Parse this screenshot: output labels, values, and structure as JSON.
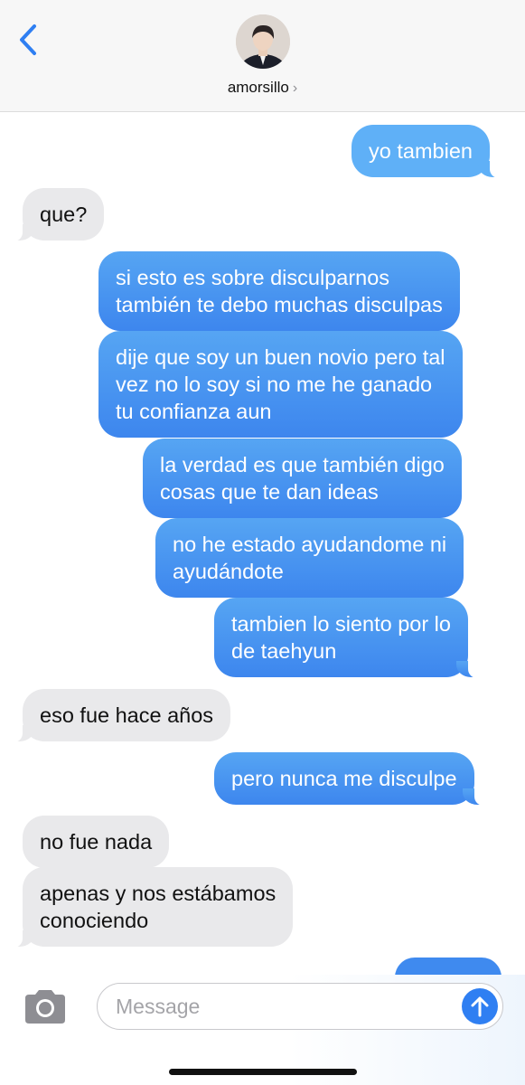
{
  "header": {
    "contact_name": "amorsillo",
    "icons": {
      "back": "chevron-left-icon",
      "details": "chevron-right-icon"
    }
  },
  "messages": [
    {
      "direction": "outgoing",
      "lines": [
        "yo tambien"
      ]
    },
    {
      "direction": "incoming",
      "lines": [
        "que?"
      ]
    },
    {
      "direction": "outgoing",
      "lines": [
        "si esto es sobre disculparnos",
        "también te debo muchas disculpas"
      ]
    },
    {
      "direction": "outgoing",
      "lines": [
        "dije que soy un buen novio pero tal",
        "vez no lo soy si no me he ganado",
        "tu confianza aun"
      ]
    },
    {
      "direction": "outgoing",
      "lines": [
        "la verdad es que también digo",
        "cosas que te dan ideas"
      ]
    },
    {
      "direction": "outgoing",
      "lines": [
        "no he estado ayudandome ni",
        "ayudándote"
      ]
    },
    {
      "direction": "outgoing",
      "lines": [
        "tambien lo siento por lo",
        "de taehyun"
      ]
    },
    {
      "direction": "incoming",
      "lines": [
        "eso fue hace años"
      ]
    },
    {
      "direction": "outgoing",
      "lines": [
        "pero nunca me disculpe"
      ]
    },
    {
      "direction": "incoming",
      "lines": [
        "no fue nada"
      ]
    },
    {
      "direction": "incoming",
      "lines": [
        "apenas y nos estábamos",
        "conociendo"
      ]
    }
  ],
  "composer": {
    "placeholder": "Message",
    "icons": {
      "camera": "camera-icon",
      "send": "arrow-up-icon"
    }
  },
  "colors": {
    "outgoing_bubble": "#3d86ee",
    "incoming_bubble": "#e9e9eb",
    "accent": "#2f7ff2"
  }
}
